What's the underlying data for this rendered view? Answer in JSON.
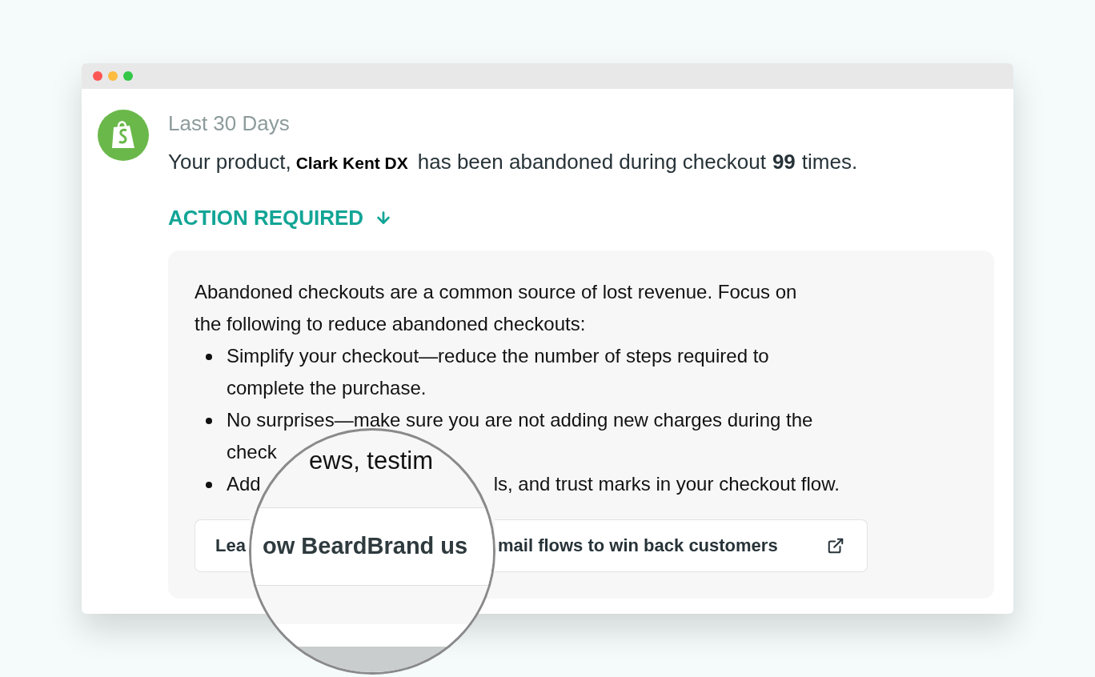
{
  "header": {
    "period": "Last 30 Days"
  },
  "message": {
    "before": "Your product,",
    "product": "Clark Kent DX",
    "middle": "has been abandoned during checkout",
    "count": "99",
    "after": "times."
  },
  "action": {
    "label": "ACTION REQUIRED"
  },
  "panel": {
    "intro_lines": [
      "Abandoned checkouts are a common source of lost revenue. Focus on",
      "the following to reduce abandoned checkouts:"
    ],
    "bullets": [
      {
        "lines": [
          "Simplify your checkout—reduce the number of steps required to",
          "complete the purchase."
        ]
      },
      {
        "lines": [
          "No surprises—make sure you are not adding new charges during the",
          "check"
        ]
      },
      {
        "fragments": [
          "Add",
          "ls, and trust marks in your checkout flow."
        ]
      }
    ],
    "link_button": {
      "fragments": [
        "Lea",
        "mail flows to win back customers"
      ]
    }
  },
  "magnifier": {
    "text": "ews, testim",
    "button_text": "ow BeardBrand us"
  }
}
